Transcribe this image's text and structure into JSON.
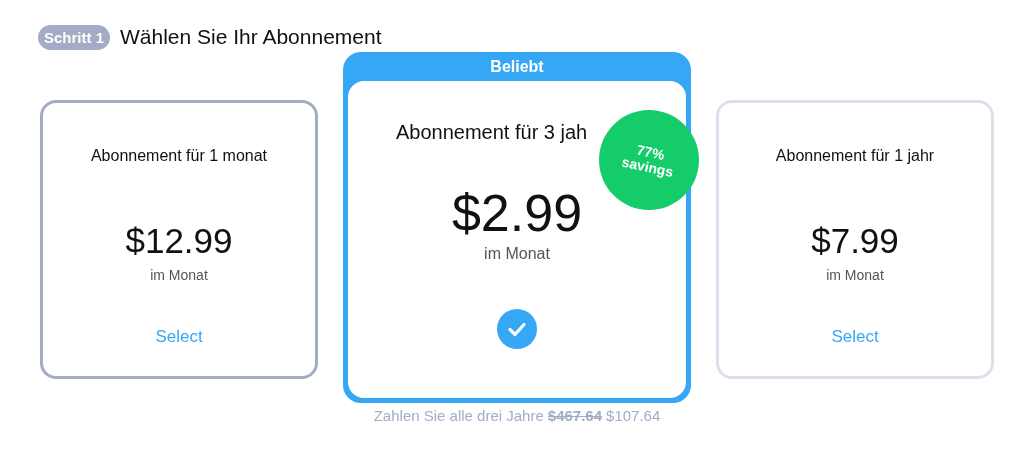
{
  "step": {
    "badge": "Schritt 1",
    "title": "Wählen Sie Ihr Abonnement"
  },
  "plans": [
    {
      "title": "Abonnement für 1 monat",
      "price": "$12.99",
      "period": "im Monat",
      "action": "Select",
      "selected": false
    },
    {
      "ribbon": "Beliebt",
      "title": "Abonnement für 3 jah",
      "price": "$2.99",
      "period": "im Monat",
      "selected": true,
      "savings": {
        "percent": "77%",
        "label": "savings"
      },
      "note": {
        "text": "Zahlen Sie alle drei Jahre",
        "old_price": "$467.64",
        "new_price": "$107.64"
      }
    },
    {
      "title": "Abonnement für 1 jahr",
      "price": "$7.99",
      "period": "im Monat",
      "action": "Select",
      "selected": false
    }
  ]
}
